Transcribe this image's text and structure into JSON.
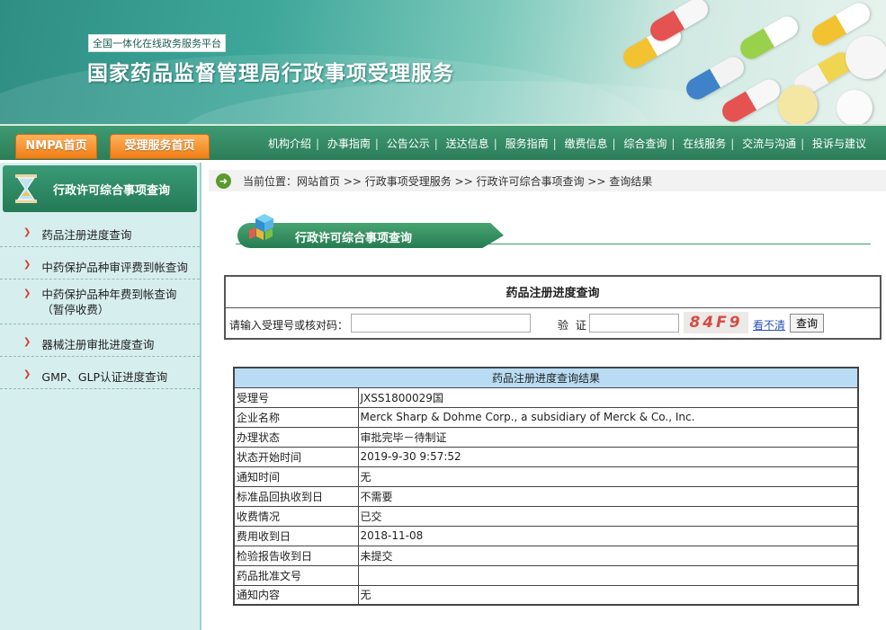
{
  "header": {
    "platform_tag": "全国一体化在线政务服务平台",
    "site_title": "国家药品监督管理局行政事项受理服务"
  },
  "nav": {
    "home_btn": "NMPA首页",
    "service_btn": "受理服务首页",
    "links": [
      "机构介绍",
      "办事指南",
      "公告公示",
      "送达信息",
      "服务指南",
      "缴费信息",
      "综合查询",
      "在线服务",
      "交流与沟通",
      "投诉与建议"
    ]
  },
  "sidebar": {
    "title": "行政许可综合事项查询",
    "items": [
      {
        "label": "药品注册进度查询"
      },
      {
        "label": "中药保护品种审评费到帐查询"
      },
      {
        "label": "中药保护品种年费到帐查询（暂停收费）"
      },
      {
        "label": "器械注册审批进度查询"
      },
      {
        "label": "GMP、GLP认证进度查询"
      }
    ]
  },
  "breadcrumb": {
    "text": "当前位置：网站首页 >> 行政事项受理服务 >> 行政许可综合事项查询 >> 查询结果"
  },
  "section_banner": {
    "title": "行政许可综合事项查询"
  },
  "query": {
    "title": "药品注册进度查询",
    "input_label": "请输入受理号或核对码：",
    "input_value": "",
    "captcha_label": "验 证 码：",
    "captcha_value": "",
    "captcha_text": "84F9",
    "refresh_label": "看不清",
    "submit_label": "查询"
  },
  "results": {
    "title": "药品注册进度查询结果",
    "rows": [
      {
        "key": "受理号",
        "value": "JXSS1800029国"
      },
      {
        "key": "企业名称",
        "value": "Merck Sharp & Dohme Corp., a subsidiary of Merck & Co., Inc."
      },
      {
        "key": "办理状态",
        "value": "审批完毕－待制证"
      },
      {
        "key": "状态开始时间",
        "value": "2019-9-30 9:57:52"
      },
      {
        "key": "通知时间",
        "value": "无"
      },
      {
        "key": "标准品回执收到日",
        "value": "不需要"
      },
      {
        "key": "收费情况",
        "value": "已交"
      },
      {
        "key": "费用收到日",
        "value": "2018-11-08"
      },
      {
        "key": "检验报告收到日",
        "value": "未提交"
      },
      {
        "key": "药品批准文号",
        "value": ""
      },
      {
        "key": "通知内容",
        "value": "无"
      }
    ]
  },
  "colors": {
    "nav_green": "#2c7d58",
    "orange_button": "#f17d14",
    "sidebar_bg": "#d7eeee",
    "result_header": "#b9dcf4",
    "captcha_red": "#d84a46"
  },
  "icons": [
    "hourglass-icon",
    "arrow-right-circle-icon",
    "cube-stack-icon",
    "red-chevron-icon"
  ]
}
